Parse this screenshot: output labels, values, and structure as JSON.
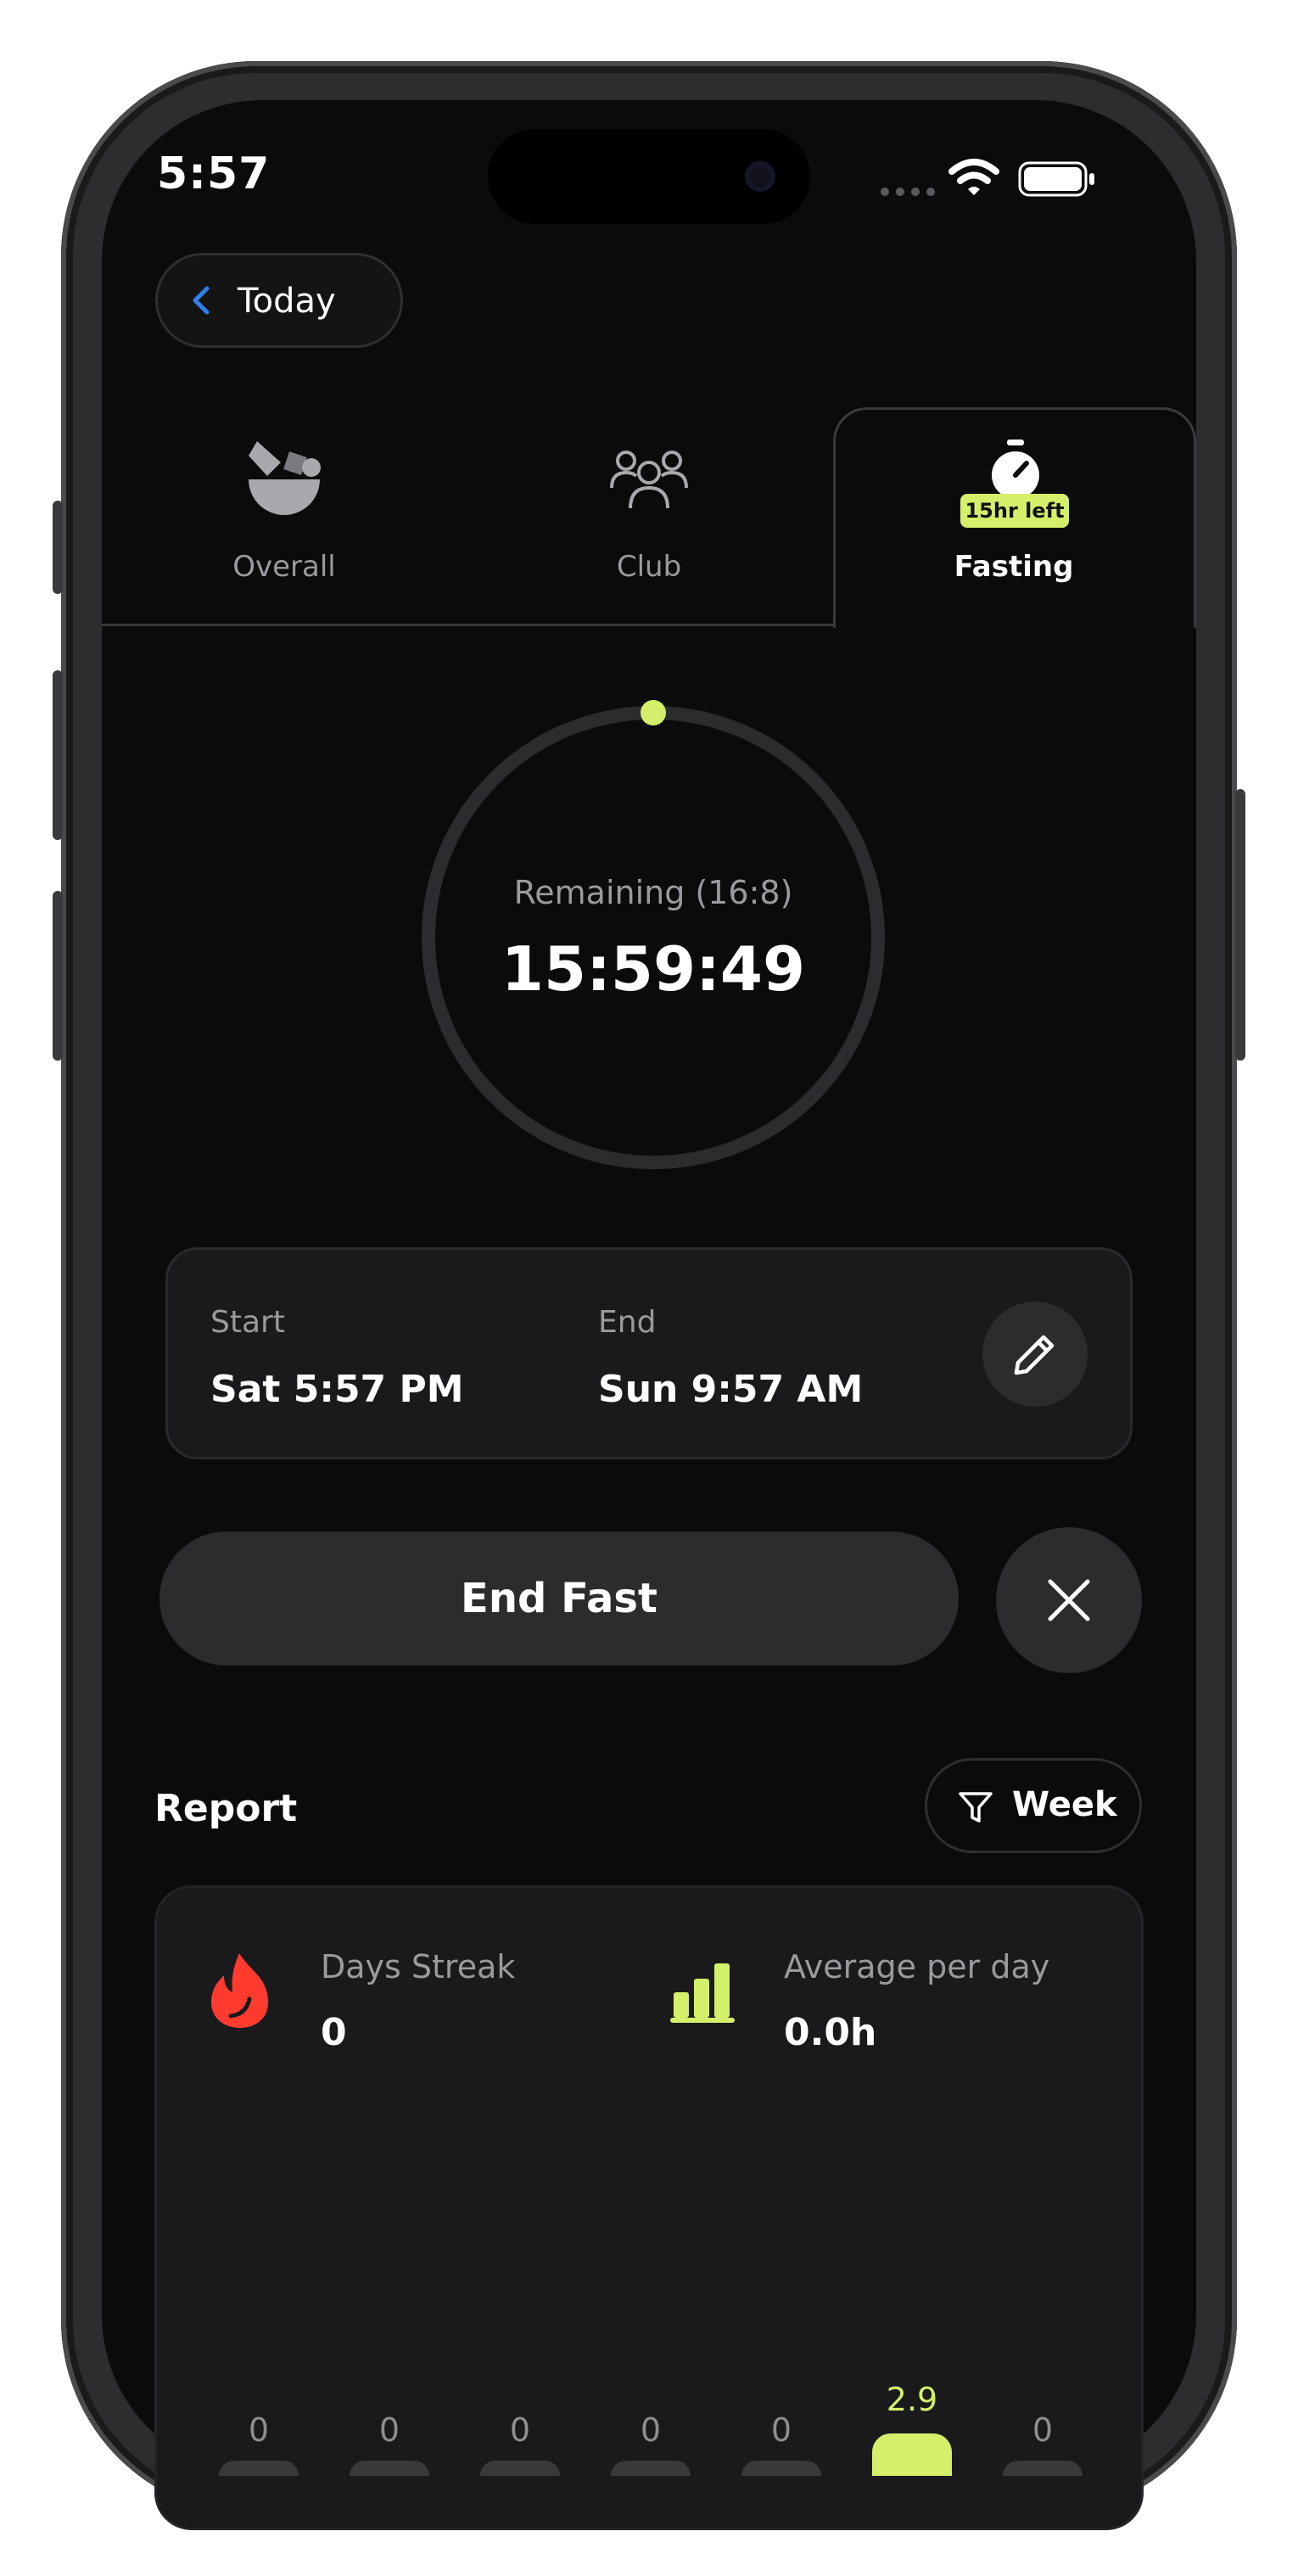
{
  "status_bar": {
    "time": "5:57"
  },
  "back": {
    "label": "Today"
  },
  "tabs": [
    {
      "label": "Overall"
    },
    {
      "label": "Club"
    },
    {
      "label": "Fasting",
      "badge": "15hr left"
    }
  ],
  "timer": {
    "label": "Remaining (16:8)",
    "value": "15:59:49",
    "progress": 0.0
  },
  "schedule": {
    "start_label": "Start",
    "start_value": "Sat 5:57 PM",
    "end_label": "End",
    "end_value": "Sun 9:57 AM"
  },
  "actions": {
    "end_fast": "End Fast"
  },
  "report": {
    "title": "Report",
    "period": "Week",
    "streak_label": "Days Streak",
    "streak_value": "0",
    "average_label": "Average per day",
    "average_value": "0.0h"
  },
  "chart_data": {
    "type": "bar",
    "categories": [],
    "values": [
      0,
      0,
      0,
      0,
      0,
      2.9,
      0
    ],
    "labels": [
      "0",
      "0",
      "0",
      "0",
      "0",
      "2.9",
      "0"
    ],
    "highlight_index": 5
  },
  "colors": {
    "accent": "#d4f06a",
    "link_blue": "#2f80ed",
    "streak_red": "#ff3b30",
    "background": "#0b0b0b",
    "card": "#1a1a1c"
  }
}
